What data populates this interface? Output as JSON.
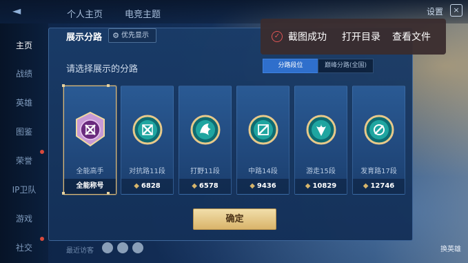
{
  "top_tabs": [
    "个人主页",
    "电竞主题"
  ],
  "settings_label": "设置",
  "close_label": "×",
  "sidebar_items": [
    "主页",
    "战绩",
    "英雄",
    "图鉴",
    "荣誉",
    "IP卫队",
    "游戏",
    "社交"
  ],
  "recent_label": "最近访客",
  "hero_btn_label": "换英雄",
  "panel": {
    "title": "展示分路",
    "pref_label": "优先显示",
    "subtitle": "请选择展示的分路",
    "seg_active": "分路段位",
    "seg_inactive": "巅峰分路(全国)"
  },
  "cards": [
    {
      "name": "全能高手",
      "footer": "全能称号",
      "emblem_color": "#8a3d9a",
      "selected": true
    },
    {
      "name": "对抗路11段",
      "points": "6828",
      "emblem_color": "#1fa5a0"
    },
    {
      "name": "打野11段",
      "points": "6578",
      "emblem_color": "#1fa5a0"
    },
    {
      "name": "中路14段",
      "points": "9436",
      "emblem_color": "#1fa5a0"
    },
    {
      "name": "游走15段",
      "points": "10829",
      "emblem_color": "#1fa5a0"
    },
    {
      "name": "发育路17段",
      "points": "12746",
      "emblem_color": "#1fa5a0"
    }
  ],
  "confirm_label": "确定",
  "toast": {
    "message": "截图成功",
    "action_open_dir": "打开目录",
    "action_view_file": "查看文件"
  },
  "colors": {
    "accent_gold": "#d9b46a",
    "segment_blue": "#2f6fcc",
    "toast_bg": "#3a2c2e"
  }
}
